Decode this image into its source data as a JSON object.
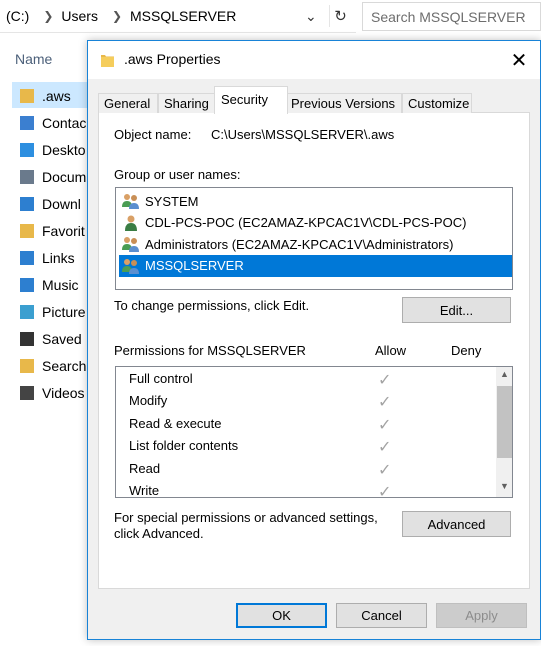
{
  "explorer": {
    "breadcrumb": [
      "(C:)",
      "Users",
      "MSSQLSERVER"
    ],
    "search_placeholder": "Search MSSQLSERVER",
    "column_name": "Name",
    "nav_items": [
      {
        "label": ".aws",
        "icon": "folder-icon",
        "color": "#e8b84a"
      },
      {
        "label": "Contac",
        "icon": "contacts-folder-icon",
        "color": "#3b7fd0"
      },
      {
        "label": "Deskto",
        "icon": "desktop-folder-icon",
        "color": "#2d8fe0"
      },
      {
        "label": "Docum",
        "icon": "documents-folder-icon",
        "color": "#6a7a8c"
      },
      {
        "label": "Downl",
        "icon": "downloads-folder-icon",
        "color": "#2d7fd0"
      },
      {
        "label": "Favorit",
        "icon": "favorites-folder-icon",
        "color": "#e8b84a"
      },
      {
        "label": "Links",
        "icon": "links-folder-icon",
        "color": "#2d7fd0"
      },
      {
        "label": "Music",
        "icon": "music-folder-icon",
        "color": "#2d7fd0"
      },
      {
        "label": "Picture",
        "icon": "pictures-folder-icon",
        "color": "#3b9fd0"
      },
      {
        "label": "Saved",
        "icon": "saved-games-folder-icon",
        "color": "#333333"
      },
      {
        "label": "Search",
        "icon": "searches-folder-icon",
        "color": "#e8b84a"
      },
      {
        "label": "Videos",
        "icon": "videos-folder-icon",
        "color": "#444444"
      }
    ]
  },
  "dialog": {
    "title": ".aws Properties",
    "tabs": [
      {
        "label": "General",
        "active": false
      },
      {
        "label": "Sharing",
        "active": false
      },
      {
        "label": "Security",
        "active": true
      },
      {
        "label": "Previous Versions",
        "active": false
      },
      {
        "label": "Customize",
        "active": false
      }
    ],
    "object_name_label": "Object name:",
    "object_name_value": "C:\\Users\\MSSQLSERVER\\.aws",
    "group_label": "Group or user names:",
    "users": [
      {
        "name": "SYSTEM",
        "icon": "group-users-icon",
        "selected": false
      },
      {
        "name": "CDL-PCS-POC (EC2AMAZ-KPCAC1V\\CDL-PCS-POC)",
        "icon": "user-icon",
        "selected": false
      },
      {
        "name": "Administrators (EC2AMAZ-KPCAC1V\\Administrators)",
        "icon": "group-users-icon",
        "selected": false
      },
      {
        "name": "MSSQLSERVER",
        "icon": "group-users-icon",
        "selected": true
      }
    ],
    "change_permissions_text": "To change permissions, click Edit.",
    "edit_button": "Edit...",
    "permissions_for_label": "Permissions for MSSQLSERVER",
    "allow_header": "Allow",
    "deny_header": "Deny",
    "permissions": [
      {
        "name": "Full control",
        "allow": true,
        "deny": false
      },
      {
        "name": "Modify",
        "allow": true,
        "deny": false
      },
      {
        "name": "Read & execute",
        "allow": true,
        "deny": false
      },
      {
        "name": "List folder contents",
        "allow": true,
        "deny": false
      },
      {
        "name": "Read",
        "allow": true,
        "deny": false
      },
      {
        "name": "Write",
        "allow": true,
        "deny": false
      }
    ],
    "special_text_line1": "For special permissions or advanced settings,",
    "special_text_line2": "click Advanced.",
    "advanced_button": "Advanced",
    "ok_button": "OK",
    "cancel_button": "Cancel",
    "apply_button": "Apply",
    "accent_color": "#0078d7"
  }
}
